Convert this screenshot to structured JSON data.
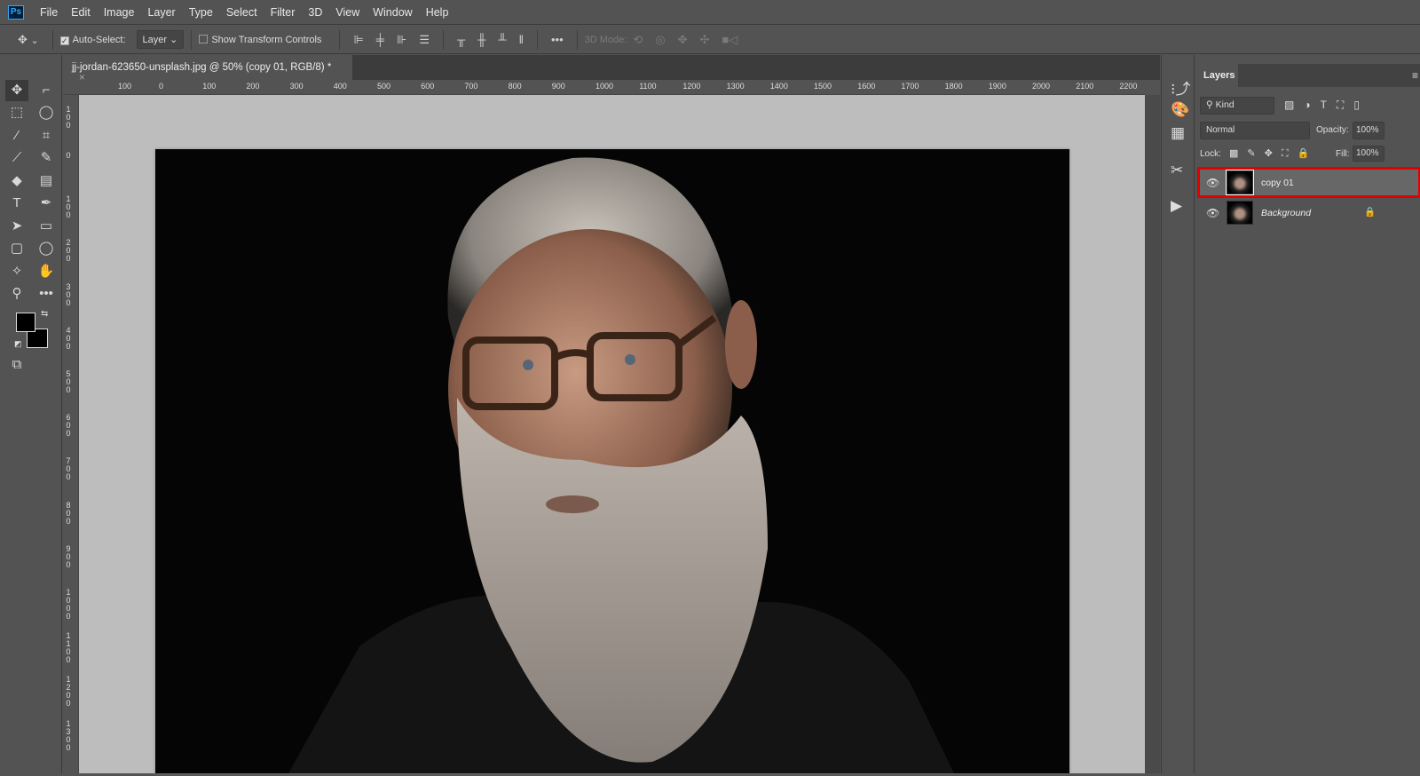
{
  "menubar": {
    "logo": "Ps",
    "items": [
      "File",
      "Edit",
      "Image",
      "Layer",
      "Type",
      "Select",
      "Filter",
      "3D",
      "View",
      "Window",
      "Help"
    ]
  },
  "options": {
    "auto_select_label": "Auto-Select:",
    "auto_select_checked": true,
    "target": "Layer",
    "show_transform_label": "Show Transform Controls",
    "show_transform_checked": false,
    "more": "•••",
    "mode_3d_label": "3D Mode:"
  },
  "document": {
    "tab_title": "jj-jordan-623650-unsplash.jpg @ 50% (copy 01, RGB/8) *",
    "close": "×"
  },
  "rulers": {
    "top": [
      "100",
      "0",
      "100",
      "200",
      "300",
      "400",
      "500",
      "600",
      "700",
      "800",
      "900",
      "1000",
      "1100",
      "1200",
      "1300",
      "1400",
      "1500",
      "1600",
      "1700",
      "1800",
      "1900",
      "2000",
      "2100",
      "2200"
    ],
    "left": [
      "100",
      "0",
      "100",
      "200",
      "300",
      "400",
      "500",
      "600",
      "700",
      "800",
      "900",
      "1000",
      "1100",
      "1200",
      "1300"
    ]
  },
  "layers_panel": {
    "tab": "Layers",
    "filter_kind": "Kind",
    "blend_mode": "Normal",
    "opacity_label": "Opacity:",
    "opacity": "100%",
    "lock_label": "Lock:",
    "fill_label": "Fill:",
    "fill": "100%",
    "layers": [
      {
        "name": "copy 01",
        "selected": true,
        "visible": true
      },
      {
        "name": "Background",
        "selected": false,
        "visible": true,
        "locked": true
      }
    ]
  },
  "colors": {
    "highlight": "#e00000",
    "accent": "#31a8ff"
  }
}
